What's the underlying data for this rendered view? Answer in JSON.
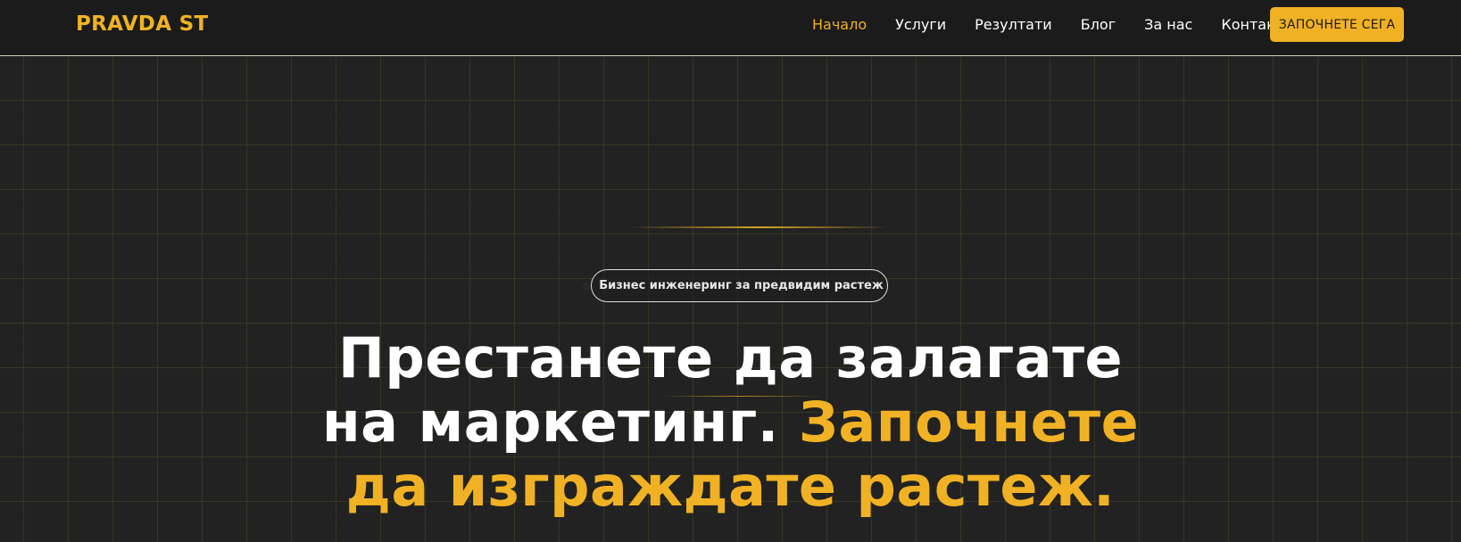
{
  "brand": {
    "logo_text": "PRAVDA ST"
  },
  "nav": {
    "items": [
      {
        "label": "Начало",
        "active": true
      },
      {
        "label": "Услуги",
        "active": false
      },
      {
        "label": "Резултати",
        "active": false
      },
      {
        "label": "Блог",
        "active": false
      },
      {
        "label": "За нас",
        "active": false
      },
      {
        "label": "Контакти",
        "active": false
      }
    ],
    "cta_label": "ЗАПОЧНЕТЕ СЕГА"
  },
  "hero": {
    "tagline": "Бизнес инженеринг за предвидим растеж",
    "title_line1": "Престанете да залагате",
    "title_line2_white": "на маркетинг. ",
    "title_line2_accent": "Започнете",
    "title_line3_accent": "да изграждате растеж."
  },
  "colors": {
    "accent": "#f0b224",
    "background": "#222222",
    "navbar": "#1b1b1b",
    "text": "#ffffff"
  }
}
